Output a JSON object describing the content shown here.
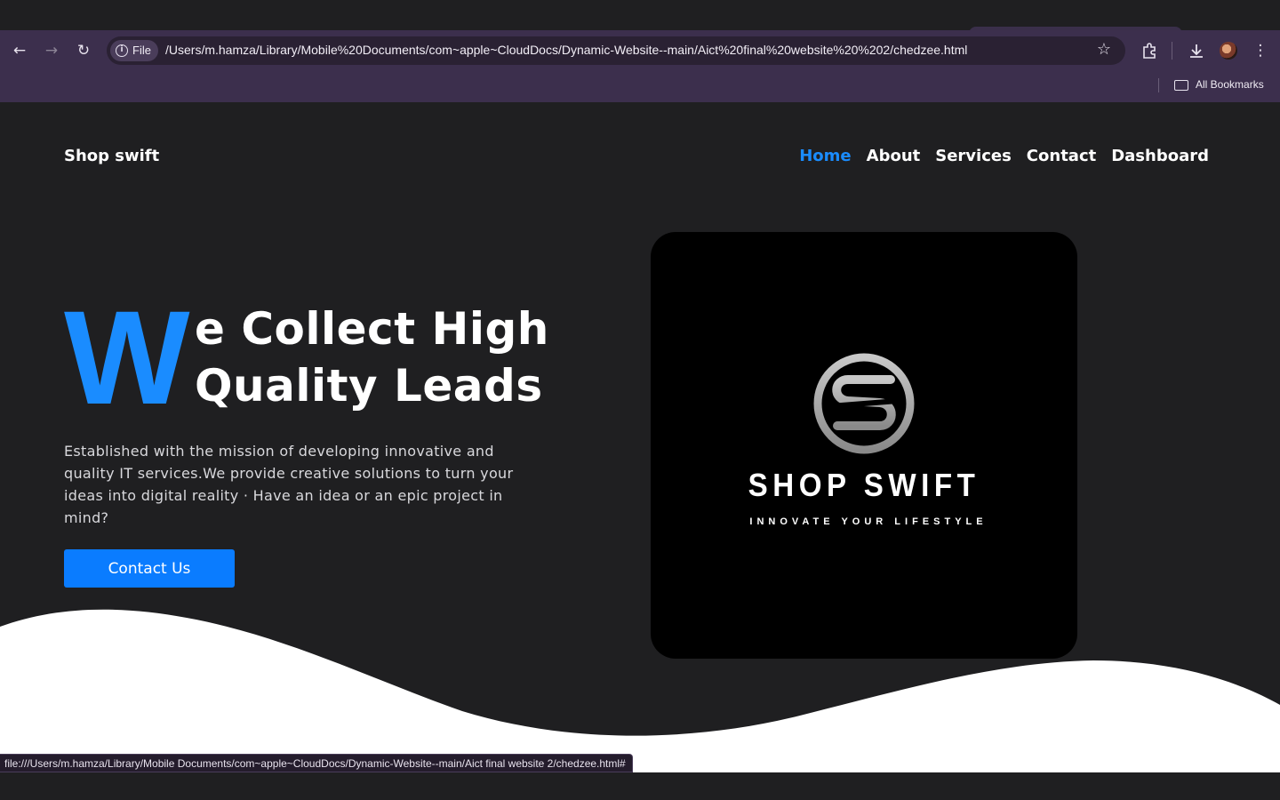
{
  "browser": {
    "file_chip_label": "File",
    "url": "/Users/m.hamza/Library/Mobile%20Documents/com~apple~CloudDocs/Dynamic-Website--main/Aict%20final%20website%20%202/chedzee.html",
    "bookmarks_label": "All Bookmarks",
    "status_url": "file:///Users/m.hamza/Library/Mobile Documents/com~apple~CloudDocs/Dynamic-Website--main/Aict final website  2/chedzee.html#",
    "icons": [
      "back-icon",
      "forward-icon",
      "reload-icon",
      "info-icon",
      "star-icon",
      "extensions-icon",
      "download-icon",
      "avatar",
      "kebab-menu-icon",
      "folder-icon"
    ]
  },
  "site": {
    "brand": "Shop swift",
    "nav": [
      {
        "label": "Home",
        "active": true
      },
      {
        "label": "About",
        "active": false
      },
      {
        "label": "Services",
        "active": false
      },
      {
        "label": "Contact",
        "active": false
      },
      {
        "label": "Dashboard",
        "active": false
      }
    ],
    "hero": {
      "big_letter": "W",
      "title_line1": "e Collect High",
      "title_line2": "Quality Leads",
      "description": "Established with the mission of developing innovative and quality IT services.We provide creative solutions to turn your ideas into digital reality · Have an idea or an epic project in mind?",
      "cta_label": "Contact Us"
    },
    "logo": {
      "name": "SHOP SWIFT",
      "tagline": "INNOVATE YOUR LIFESTYLE"
    }
  },
  "colors": {
    "accent": "#1a8cff",
    "button": "#0a7cff",
    "page_bg": "#1f1f21",
    "toolbar_bg": "#3c2f4d",
    "wave": "#ffffff"
  }
}
